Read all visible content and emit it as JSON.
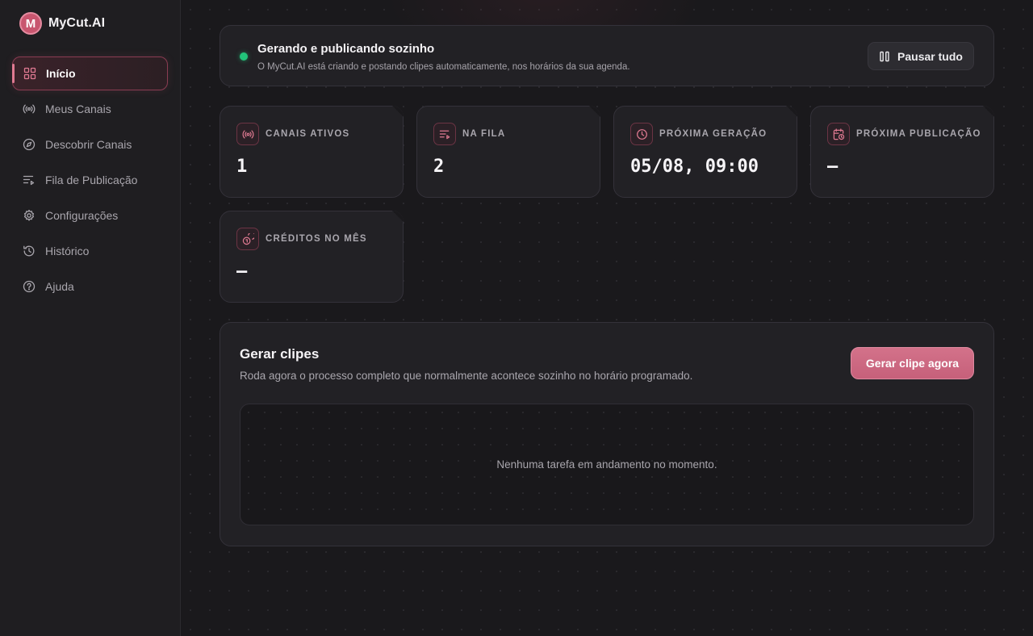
{
  "brand": {
    "logo_letter": "M",
    "name": "MyCut.AI"
  },
  "sidebar": {
    "items": [
      {
        "label": "Início",
        "icon": "grid-icon",
        "active": true
      },
      {
        "label": "Meus Canais",
        "icon": "broadcast-icon",
        "active": false
      },
      {
        "label": "Descobrir Canais",
        "icon": "compass-icon",
        "active": false
      },
      {
        "label": "Fila de Publicação",
        "icon": "queue-icon",
        "active": false
      },
      {
        "label": "Configurações",
        "icon": "gear-icon",
        "active": false
      },
      {
        "label": "Histórico",
        "icon": "history-icon",
        "active": false
      },
      {
        "label": "Ajuda",
        "icon": "help-icon",
        "active": false
      }
    ]
  },
  "status": {
    "title": "Gerando e publicando sozinho",
    "subtitle": "O MyCut.AI está criando e postando clipes automaticamente, nos horários da sua agenda.",
    "pause_label": "Pausar tudo",
    "dot_color": "#22c47a"
  },
  "stats": [
    {
      "label": "CANAIS ATIVOS",
      "value": "1",
      "icon": "broadcast-icon"
    },
    {
      "label": "NA FILA",
      "value": "2",
      "icon": "queue-icon"
    },
    {
      "label": "PRÓXIMA GERAÇÃO",
      "value": "05/08, 09:00",
      "icon": "clock-icon"
    },
    {
      "label": "PRÓXIMA PUBLICAÇÃO",
      "value": "–",
      "icon": "calendar-clock-icon"
    },
    {
      "label": "CRÉDITOS NO MÊS",
      "value": "–",
      "icon": "coins-icon"
    }
  ],
  "generate": {
    "title": "Gerar clipes",
    "subtitle": "Roda agora o processo completo que normalmente acontece sozinho no horário programado.",
    "button_label": "Gerar clipe agora",
    "empty_text": "Nenhuma tarefa em andamento no momento."
  },
  "colors": {
    "accent": "#c8566f",
    "accent_light": "#e07a92",
    "background": "#1a191c"
  }
}
